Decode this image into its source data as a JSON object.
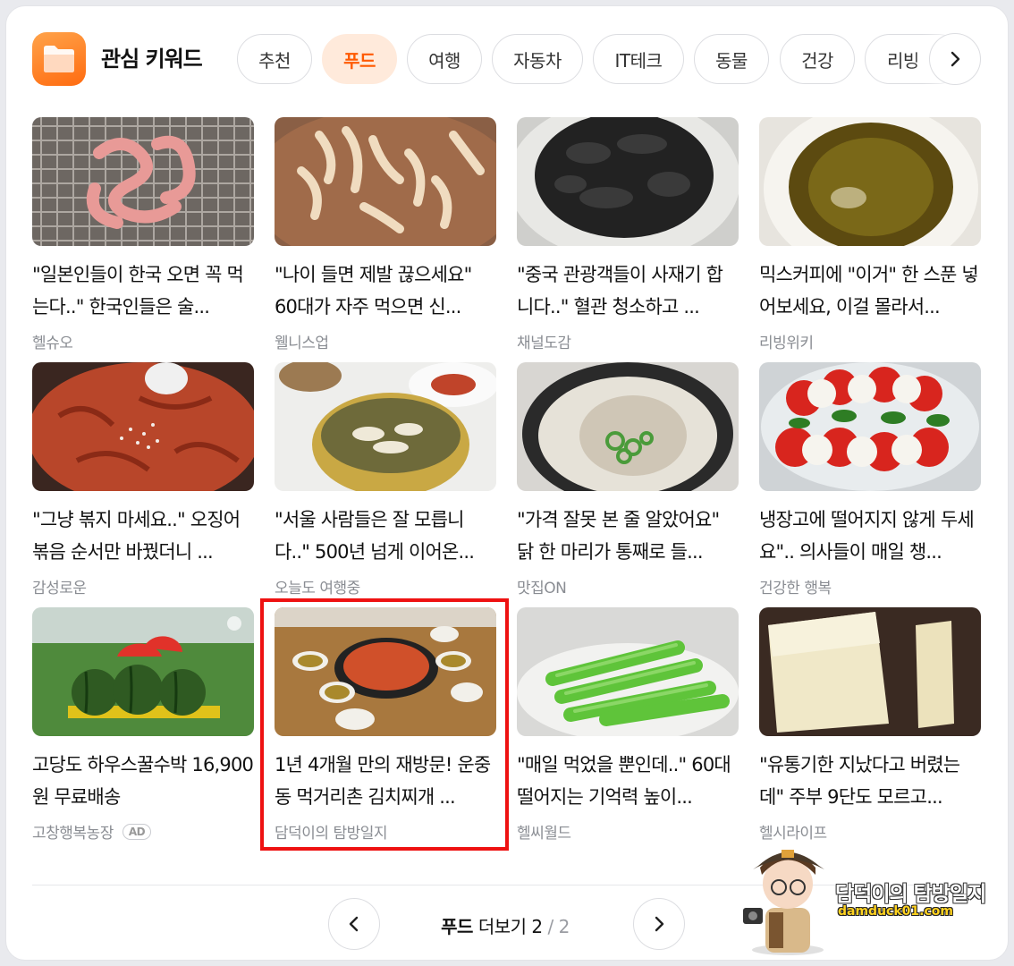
{
  "header": {
    "title": "관심 키워드",
    "tabs": [
      "추천",
      "푸드",
      "여행",
      "자동차",
      "IT테크",
      "동물",
      "건강",
      "리빙"
    ],
    "active_tab": "푸드"
  },
  "items": [
    {
      "headline": "\"일본인들이 한국 오면 꼭 먹는다..\" 한국인들은 술...",
      "source": "헬슈오"
    },
    {
      "headline": "\"나이 들면 제발 끊으세요\" 60대가 자주 먹으면 신...",
      "source": "웰니스업"
    },
    {
      "headline": "\"중국 관광객들이 사재기 합니다..\" 혈관 청소하고 ...",
      "source": "채널도감"
    },
    {
      "headline": "믹스커피에 \"이거\" 한 스푼 넣어보세요, 이걸 몰라서...",
      "source": "리빙위키"
    },
    {
      "headline": "\"그냥 볶지 마세요..\" 오징어볶음 순서만 바꿨더니 ...",
      "source": "감성로운"
    },
    {
      "headline": "\"서울 사람들은 잘 모릅니다..\" 500년 넘게 이어온...",
      "source": "오늘도 여행중"
    },
    {
      "headline": "\"가격 잘못 본 줄 알았어요\" 닭 한 마리가 통째로 들...",
      "source": "맛집ON"
    },
    {
      "headline": "냉장고에 떨어지지 않게 두세요\".. 의사들이 매일 챙...",
      "source": "건강한 행복"
    },
    {
      "headline": "고당도 하우스꿀수박 16,900원 무료배송",
      "source": "고창행복농장",
      "ad": "AD"
    },
    {
      "headline": "1년 4개월 만의 재방문! 운중동 먹거리촌 김치찌개 ...",
      "source": "담덕이의 탐방일지"
    },
    {
      "headline": "\"매일 먹었을 뿐인데..\" 60대 떨어지는 기억력 높이...",
      "source": "헬씨월드"
    },
    {
      "headline": "\"유통기한 지났다고 버렸는데\" 주부 9단도 모르고...",
      "source": "헬시라이프"
    }
  ],
  "pager": {
    "label_bold": "푸드",
    "label": "더보기",
    "current": "2",
    "separator": "/",
    "total": "2"
  },
  "watermark": {
    "title": "담덕이의 탐방일지",
    "url": "damduck01.com"
  },
  "colors": {
    "accent": "#ff5a00",
    "active_tab_bg": "#ffeadb",
    "highlight": "#ee1111"
  }
}
